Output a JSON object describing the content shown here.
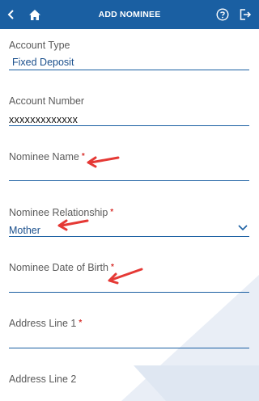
{
  "header": {
    "title": "ADD NOMINEE",
    "background": "#1a5fa2",
    "icons": [
      "chevron-left-icon",
      "home-icon",
      "help-icon",
      "logout-icon"
    ]
  },
  "form": {
    "account_type": {
      "label": "Account Type",
      "value": "Fixed Deposit"
    },
    "account_number": {
      "label": "Account Number",
      "value": "xxxxxxxxxxxxx"
    },
    "nominee_name": {
      "label": "Nominee Name",
      "required": "*",
      "value": ""
    },
    "nominee_relationship": {
      "label": "Nominee Relationship",
      "required": "*",
      "value": "Mother"
    },
    "nominee_dob": {
      "label": "Nominee Date of Birth",
      "required": "*",
      "value": ""
    },
    "address_line_1": {
      "label": "Address Line 1",
      "required": "*",
      "value": ""
    },
    "address_line_2": {
      "label": "Address Line 2"
    }
  },
  "annotations": {
    "arrow_color": "#e53935"
  }
}
